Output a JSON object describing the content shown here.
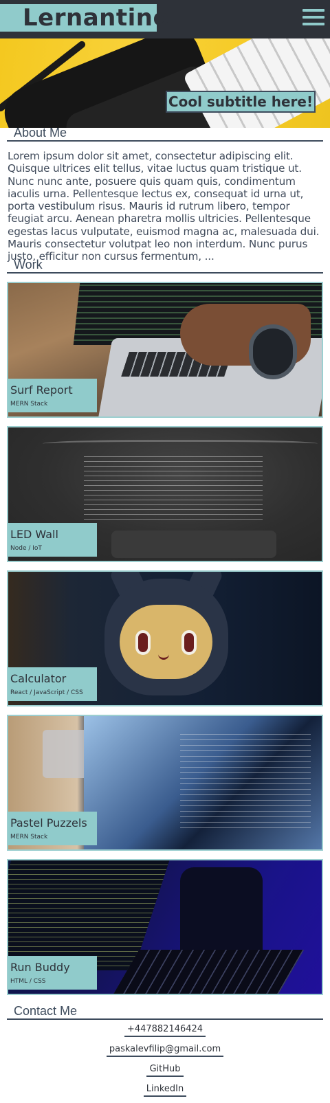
{
  "header": {
    "brand": "Lernantino",
    "menu_icon": "hamburger-menu-icon",
    "brand_color": "#90cbcb",
    "bar_color": "#2e3239"
  },
  "hero": {
    "subtitle": "Cool subtitle here!"
  },
  "about": {
    "heading": "About Me",
    "text": "Lorem ipsum dolor sit amet, consectetur adipiscing elit. Quisque ultrices elit tellus, vitae luctus quam tristique ut. Nunc nunc ante, posuere quis quam quis, condimentum iaculis urna. Pellentesque lectus ex, consequat id urna ut, porta vestibulum risus. Mauris id rutrum libero, tempor feugiat arcu. Aenean pharetra mollis ultricies. Pellentesque egestas lacus vulputate, euismod magna ac, malesuada dui. Mauris consectetur volutpat leo non interdum. Nunc purus justo, efficitur non cursus fermentum, ..."
  },
  "work": {
    "heading": "Work",
    "projects": [
      {
        "title": "Surf Report",
        "stack": "MERN Stack"
      },
      {
        "title": "LED Wall",
        "stack": "Node / IoT"
      },
      {
        "title": "Calculator",
        "stack": "React / JavaScript / CSS"
      },
      {
        "title": "Pastel Puzzels",
        "stack": "MERN Stack"
      },
      {
        "title": "Run Buddy",
        "stack": "HTML / CSS"
      }
    ]
  },
  "contact": {
    "heading": "Contact Me",
    "phone": "+447882146424",
    "email": "paskalevfilip@gmail.com",
    "github": "GitHub",
    "linkedin": "LinkedIn"
  }
}
